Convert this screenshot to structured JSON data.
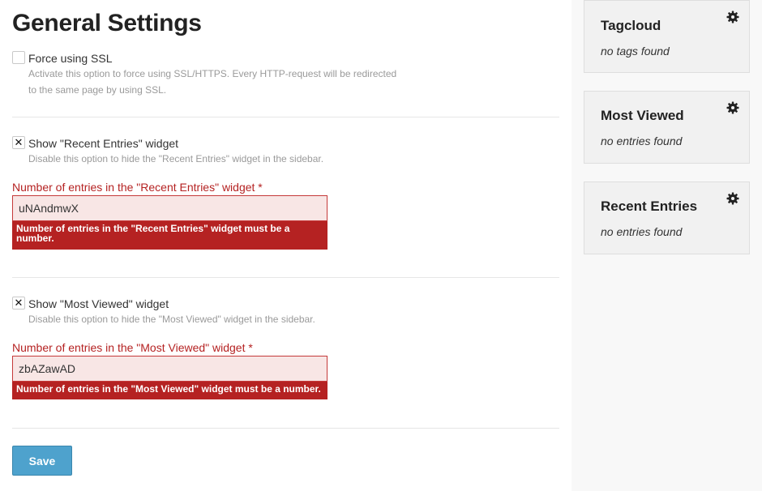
{
  "page": {
    "title": "General Settings"
  },
  "ssl": {
    "label": "Force using SSL",
    "checked": false,
    "help_line1": "Activate this option to force using SSL/HTTPS. Every HTTP-request will be redirected",
    "help_line2": "to the same page by using SSL."
  },
  "recent_entries": {
    "label": "Show \"Recent Entries\" widget",
    "checked": true,
    "check_glyph": "✕",
    "help": "Disable this option to hide the \"Recent Entries\" widget in the sidebar.",
    "field_label": "Number of entries in the \"Recent Entries\" widget *",
    "field_value": "uNAndmwX",
    "error": "Number of entries in the \"Recent Entries\" widget must be a number."
  },
  "most_viewed": {
    "label": "Show \"Most Viewed\" widget",
    "checked": true,
    "check_glyph": "✕",
    "help": "Disable this option to hide the \"Most Viewed\" widget in the sidebar.",
    "field_label": "Number of entries in the \"Most Viewed\" widget *",
    "field_value": "zbAZawAD",
    "error": "Number of entries in the \"Most Viewed\" widget must be a number."
  },
  "actions": {
    "save_label": "Save"
  },
  "sidebar": {
    "widgets": [
      {
        "title": "Tagcloud",
        "empty_text": "no tags found",
        "icon": "gear-icon"
      },
      {
        "title": "Most Viewed",
        "empty_text": "no entries found",
        "icon": "gear-icon"
      },
      {
        "title": "Recent Entries",
        "empty_text": "no entries found",
        "icon": "gear-icon"
      }
    ]
  },
  "colors": {
    "error": "#b52222",
    "error_bg": "#f8e6e5",
    "primary_button": "#4ea2cd",
    "sidebar_bg": "#f8f8f8",
    "widget_bg": "#f1f1f1"
  }
}
